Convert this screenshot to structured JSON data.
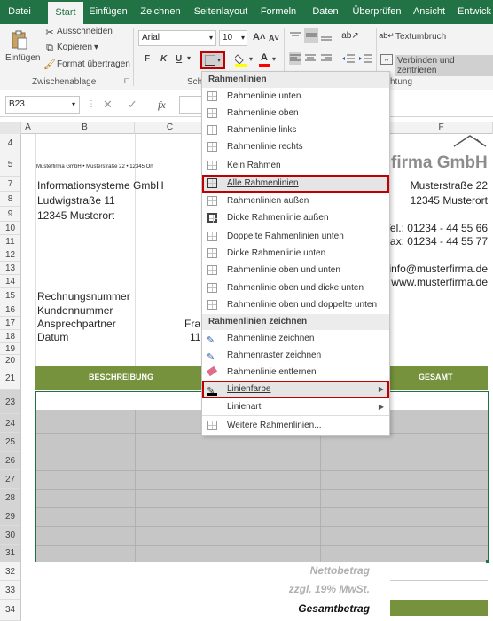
{
  "tabs": [
    "Datei",
    "Start",
    "Einfügen",
    "Zeichnen",
    "Seitenlayout",
    "Formeln",
    "Daten",
    "Überprüfen",
    "Ansicht",
    "Entwick"
  ],
  "ribbon": {
    "paste": "Einfügen",
    "cut": "Ausschneiden",
    "copy": "Kopieren",
    "format_painter": "Format übertragen",
    "clipboard_group": "Zwischenablage",
    "font_name": "Arial",
    "font_size": "10",
    "bold": "F",
    "italic": "K",
    "underline": "U",
    "font_group_partial": "Sch",
    "wrap_text": "Textumbruch",
    "merge_center": "Verbinden und zentrieren",
    "align_group_partial": "htung"
  },
  "formula_bar": {
    "name_box": "B23",
    "fx": "fx"
  },
  "columns": [
    "A",
    "B",
    "C",
    "F"
  ],
  "rows": [
    "4",
    "5",
    "7",
    "8",
    "9",
    "10",
    "11",
    "12",
    "13",
    "14",
    "15",
    "16",
    "17",
    "18",
    "19",
    "20",
    "21",
    "23",
    "24",
    "25",
    "26",
    "27",
    "28",
    "29",
    "30",
    "31",
    "32",
    "33",
    "34"
  ],
  "sheet": {
    "sender_line": "Musterfirma GmbH • Musterstraße 22 • 12345 Ort",
    "addr1": "Informationsysteme GmbH",
    "addr2": "Ludwigstraße 11",
    "addr3": "12345 Musterort",
    "company": "firma GmbH",
    "street": "Musterstraße 22",
    "city": "12345 Musterort",
    "tel": "Tel.: 01234 - 44 55 66",
    "fax": "Fax: 01234 - 44 55 77",
    "email": "info@musterfirma.de",
    "web": "www.musterfirma.de",
    "inv_no": "Rechnungsnummer",
    "cust_no": "Kundennummer",
    "contact": "Ansprechpartner",
    "contact_val": "Fra",
    "date": "Datum",
    "date_val": "11",
    "hdr_desc": "BESCHREIBUNG",
    "hdr_total": "GESAMT",
    "net": "Nettobetrag",
    "vat": "zzgl. 19% MwSt.",
    "gross": "Gesamtbetrag"
  },
  "dropdown": {
    "section1": "Rahmenlinien",
    "items1": [
      "Rahmenlinie unten",
      "Rahmenlinie oben",
      "Rahmenlinie links",
      "Rahmenlinie rechts",
      "Kein Rahmen",
      "Alle Rahmenlinien",
      "Rahmenlinien außen",
      "Dicke Rahmenlinie außen",
      "Doppelte Rahmenlinien unten",
      "Dicke Rahmenlinie unten",
      "Rahmenlinie oben und unten",
      "Rahmenlinie oben und dicke unten",
      "Rahmenlinie oben und doppelte unten"
    ],
    "section2": "Rahmenlinien zeichnen",
    "items2": [
      "Rahmenlinie zeichnen",
      "Rahmenraster zeichnen",
      "Rahmenlinie entfernen",
      "Linienfarbe",
      "Linienart",
      "Weitere Rahmenlinien..."
    ]
  },
  "colors": {
    "excel_green": "#217346",
    "header_green": "#76923c",
    "highlight_red": "#c00000",
    "sel_gray": "#c6c6c6"
  }
}
